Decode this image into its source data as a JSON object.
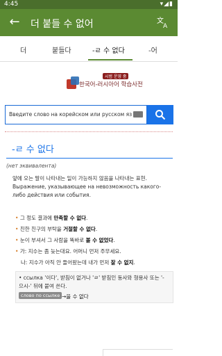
{
  "status": {
    "time": "4:45",
    "indicators": "▾◢▮"
  },
  "appbar": {
    "back_icon": "arrow-back-icon",
    "title": "더 붙들 수 없어",
    "translate_icon": "translate-icon"
  },
  "tabs": [
    {
      "label": "더"
    },
    {
      "label": "붙들다"
    },
    {
      "label": "-ㄹ 수 없다"
    },
    {
      "label": "-어"
    }
  ],
  "logo": {
    "tag": "시범 운영 중",
    "name": "한국어-러시아어 학습사전"
  },
  "search": {
    "placeholder": "Введите слово на корейском или русском яз"
  },
  "entry": {
    "headword": "-ㄹ 수 없다",
    "no_equivalent": "(нет эквивалента)",
    "def_ko": "앞에 오는 말이 나타내는 일이 가능하지 않음을 나타내는 표현.",
    "def_ru": "Выражение, указывающее на невозможность какого-либо действия или события.",
    "examples": [
      {
        "bullet": "•",
        "pre": "그 정도 결과에 ",
        "bold": "만족할 수 없다",
        "post": "."
      },
      {
        "bullet": "•",
        "pre": "친한 친구의 부탁을 ",
        "bold": "거절할 수 없다",
        "post": "."
      },
      {
        "bullet": "•",
        "pre": "눈이 부셔서 그 사람을 똑바로 ",
        "bold": "볼 수 없었다",
        "post": "."
      },
      {
        "bullet": "•",
        "pre": "가: 지수는 좀 늦는대요. 어머니 먼저 주무세요.",
        "bold": "",
        "post": ""
      },
      {
        "bullet": "",
        "pre": "나: 지수가 아직 안 들어왔는데 내가 먼저 ",
        "bold": "잘 수 없지",
        "post": "."
      }
    ],
    "note": {
      "text": "• ссылка '이다', 받침이 없거나 'ㄹ' 받침인 동사와 형용사 또는 '-으시-' 뒤에 붙여 쓴다.",
      "chip": "слово по ссылке",
      "ref": "→을 수 없다"
    }
  }
}
